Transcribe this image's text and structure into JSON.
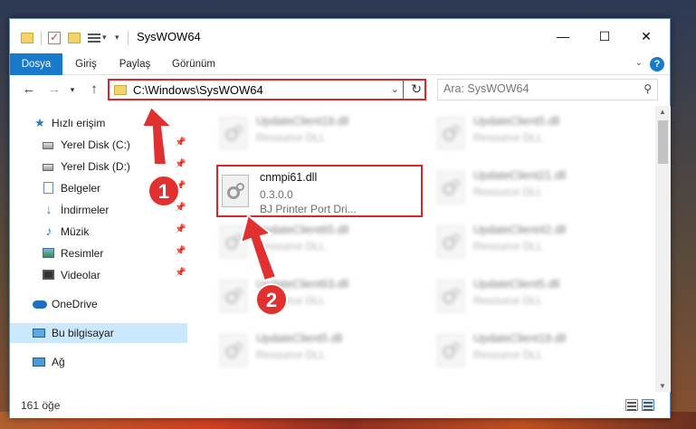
{
  "window": {
    "title": "SysWOW64"
  },
  "ribbon": {
    "tabs": [
      "Dosya",
      "Giriş",
      "Paylaş",
      "Görünüm"
    ]
  },
  "nav": {
    "address": "C:\\Windows\\SysWOW64",
    "search_placeholder": "Ara: SysWOW64"
  },
  "sidebar": {
    "quick_access": "Hızlı erişim",
    "items": [
      {
        "label": "Yerel Disk (C:)",
        "icon": "drive-icon",
        "pinned": true
      },
      {
        "label": "Yerel Disk (D:)",
        "icon": "drive-icon",
        "pinned": true
      },
      {
        "label": "Belgeler",
        "icon": "documents-icon",
        "pinned": true
      },
      {
        "label": "İndirmeler",
        "icon": "downloads-icon",
        "pinned": true
      },
      {
        "label": "Müzik",
        "icon": "music-icon",
        "pinned": true
      },
      {
        "label": "Resimler",
        "icon": "pictures-icon",
        "pinned": true
      },
      {
        "label": "Videolar",
        "icon": "videos-icon",
        "pinned": true
      }
    ],
    "onedrive": "OneDrive",
    "this_pc": "Bu bilgisayar",
    "network": "Ağ"
  },
  "files": [
    {
      "name": "UpdateClient19.dll",
      "line2": "Resource DLL",
      "line3": ""
    },
    {
      "name": "UpdateClient5.dll",
      "line2": "Resource DLL",
      "line3": ""
    },
    {
      "name": "cnmpi61.dll",
      "line2": "0.3.0.0",
      "line3": "BJ Printer Port Dri..."
    },
    {
      "name": "UpdateClient21.dll",
      "line2": "Resource DLL",
      "line3": ""
    },
    {
      "name": "UpdateClient65.dll",
      "line2": "Resource DLL",
      "line3": ""
    },
    {
      "name": "UpdateClient42.dll",
      "line2": "Resource DLL",
      "line3": ""
    },
    {
      "name": "UpdateClient63.dll",
      "line2": "Resource DLL",
      "line3": ""
    },
    {
      "name": "UpdateClient5.dll",
      "line2": "Resource DLL",
      "line3": ""
    },
    {
      "name": "UpdateClient5.dll",
      "line2": "Resource DLL",
      "line3": ""
    },
    {
      "name": "UpdateClient19.dll",
      "line2": "Resource DLL",
      "line3": ""
    }
  ],
  "status": {
    "count": "161 öğe"
  },
  "annotations": [
    {
      "label": "1",
      "color": "#d9262a"
    },
    {
      "label": "2",
      "color": "#d9262a"
    }
  ]
}
